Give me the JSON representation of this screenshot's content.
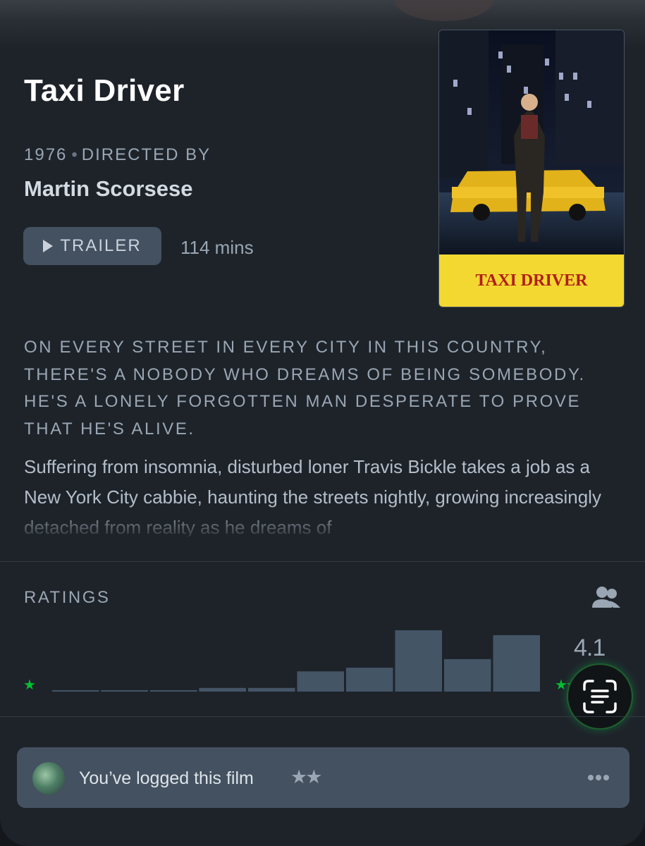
{
  "film": {
    "title": "Taxi Driver",
    "year": "1976",
    "directed_by_label": "DIRECTED BY",
    "director": "Martin Scorsese",
    "trailer_label": "TRAILER",
    "runtime": "114 mins",
    "poster_title": "TAXI DRIVER",
    "tagline": "ON EVERY STREET IN EVERY CITY IN THIS COUNTRY, THERE'S A NOBODY WHO DREAMS OF BEING SOMEBODY. HE'S A LONELY FORGOTTEN MAN DESPERATE TO PROVE THAT HE'S ALIVE.",
    "synopsis": "Suffering from insomnia, disturbed loner Travis Bickle takes a job as a New York City cabbie, haunting the streets nightly, growing increasingly detached from reality as he dreams of"
  },
  "ratings": {
    "label": "RATINGS",
    "average": "4.1",
    "min_star": "★",
    "max_stars": "★★★★★",
    "histogram_share": [
      0.015,
      0.015,
      0.015,
      0.06,
      0.06,
      0.33,
      0.39,
      1.0,
      0.53,
      0.92
    ],
    "bar_color": "#445566",
    "star_color": "#00c030"
  },
  "log": {
    "text": "You’ve logged this film",
    "rating_stars": "★★"
  },
  "icons": {
    "trailer": "play-icon",
    "ratings": "people-icon",
    "scan": "scan-text-icon",
    "more": "more-dots-icon"
  }
}
